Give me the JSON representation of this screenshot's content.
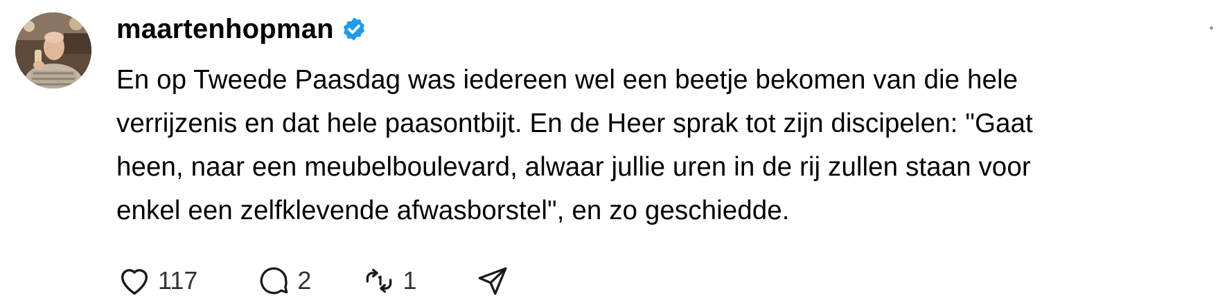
{
  "post": {
    "username": "maartenhopman",
    "verified": true,
    "text_lines": [
      "En op Tweede Paasdag was iedereen wel een beetje bekomen van die hele",
      "verrijzenis en dat hele paasontbijt. En de Heer sprak tot zijn discipelen: \"Gaat",
      "heen, naar een meubelboulevard, alwaar jullie uren in de rij zullen staan voor",
      "enkel een zelfklevende afwasborstel\", en zo geschiedde."
    ],
    "actions": {
      "like_count": "117",
      "reply_count": "2",
      "repost_count": "1"
    }
  },
  "colors": {
    "verified_badge": "#1d9bf0",
    "text": "#000000",
    "icon_stroke": "#1a1a1a"
  },
  "icons": {
    "verified": "verified-badge-icon",
    "more": "more-options-icon",
    "like": "heart-icon",
    "reply": "comment-bubble-icon",
    "repost": "repost-icon",
    "share": "send-icon"
  }
}
